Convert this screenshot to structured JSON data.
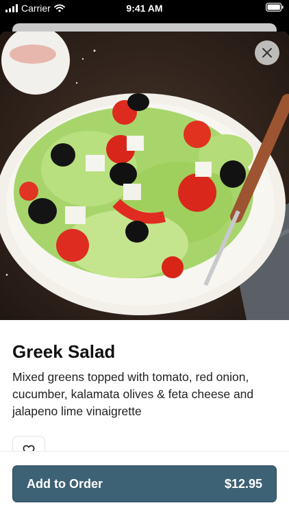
{
  "status_bar": {
    "carrier": "Carrier",
    "time": "9:41 AM"
  },
  "item": {
    "name": "Greek Salad",
    "description": "Mixed greens topped with tomato, red onion, cucumber, kalamata olives & feta cheese and jalapeno lime vinaigrette"
  },
  "icons": {
    "close": "close-icon",
    "favorite": "heart-outline-icon",
    "wifi": "wifi-icon",
    "battery": "battery-icon",
    "signal": "signal-bars-icon"
  },
  "footer": {
    "button_label": "Add to Order",
    "price": "$12.95"
  },
  "colors": {
    "accent": "#3d6175",
    "sheet_background": "#ffffff"
  }
}
